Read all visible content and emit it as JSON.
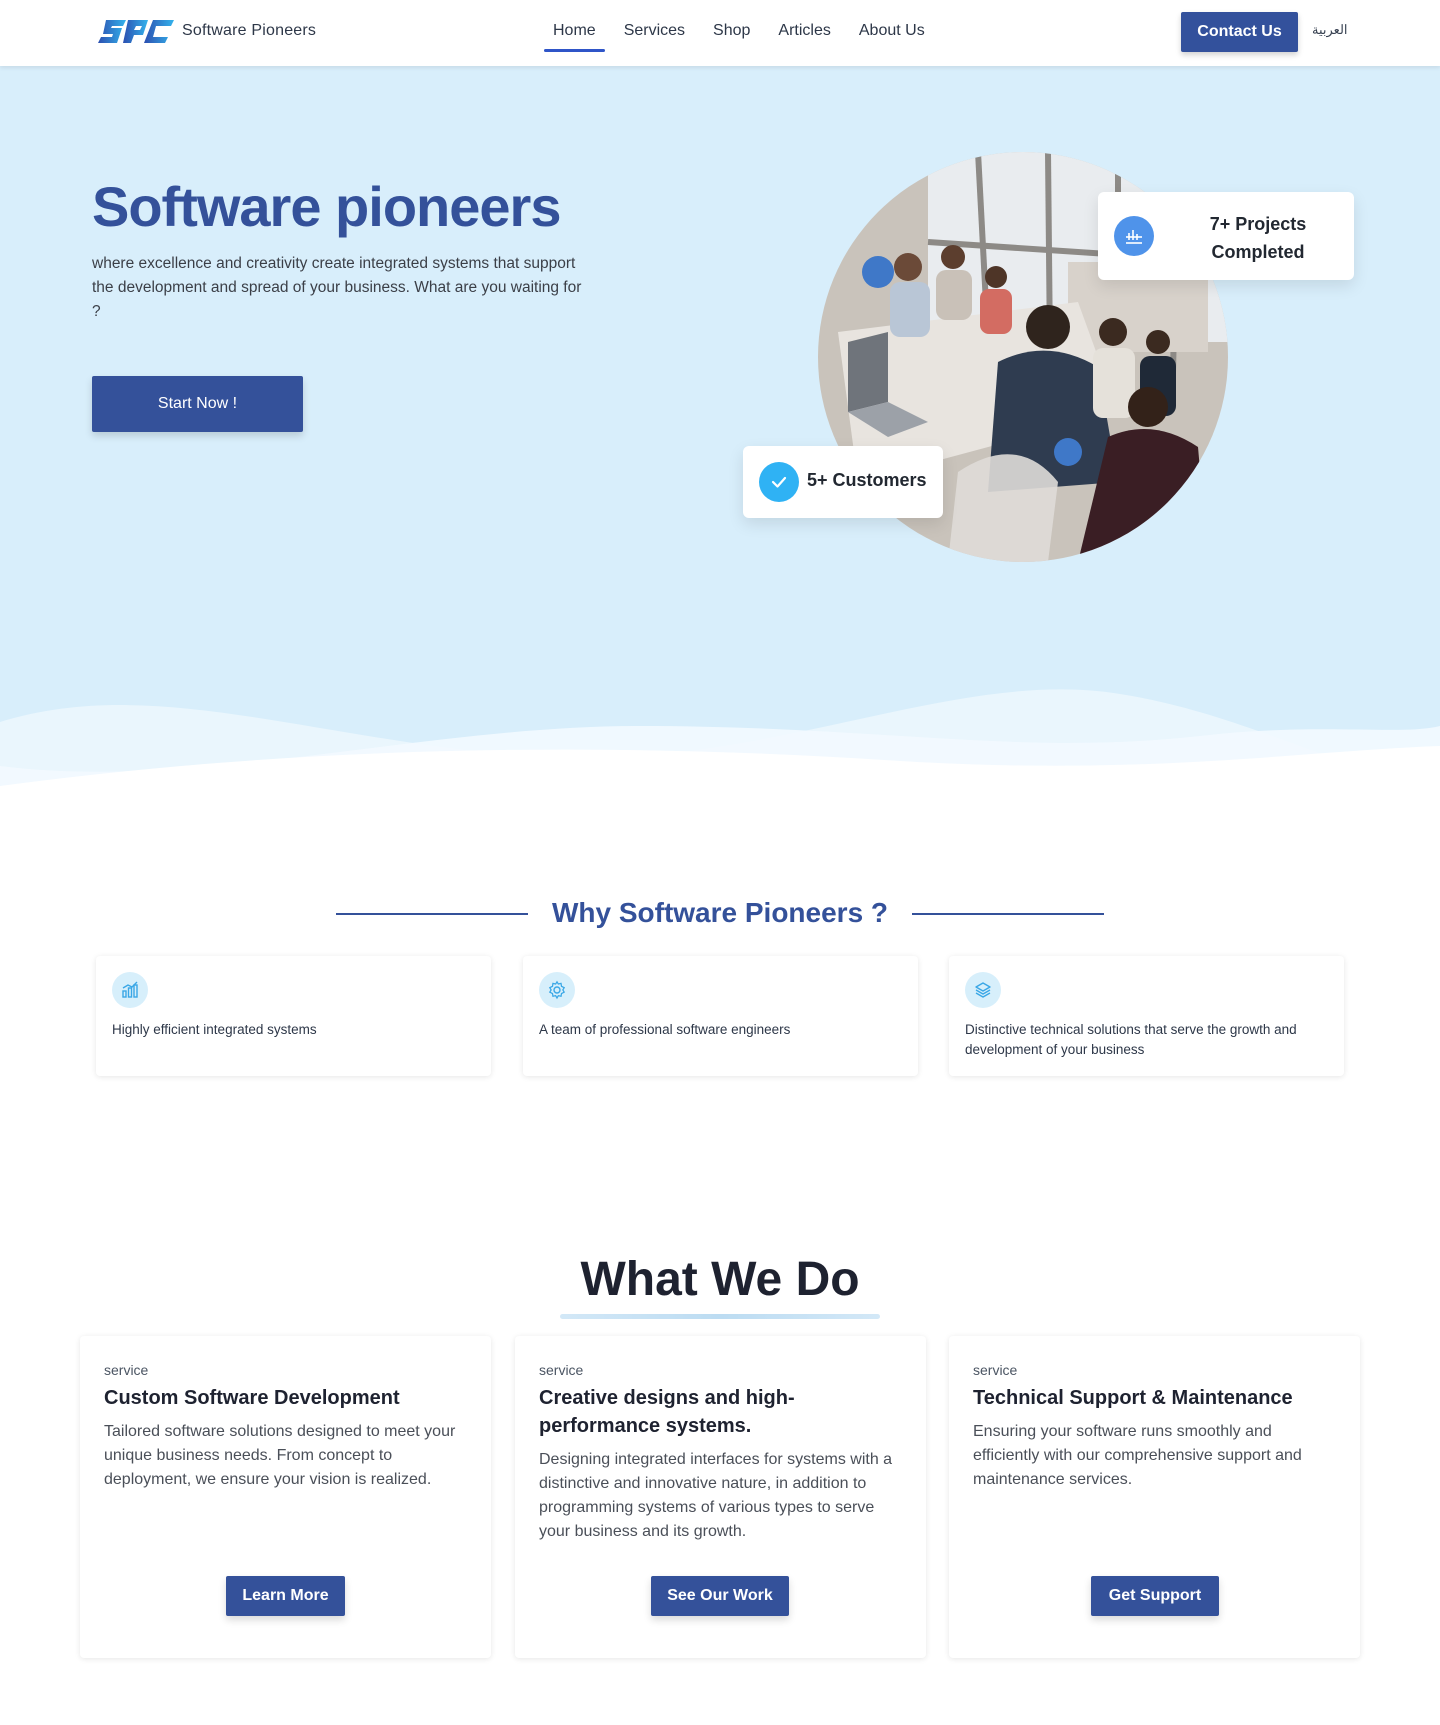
{
  "nav": {
    "brand": "Software Pioneers",
    "links": [
      "Home",
      "Services",
      "Shop",
      "Articles",
      "About Us"
    ],
    "active": "Home",
    "contact_label": "Contact Us",
    "language_label": "العربية"
  },
  "hero": {
    "title": "Software pioneers",
    "description": "where excellence and creativity create integrated systems that support the development and spread of your business. What are you waiting for ?",
    "cta_label": "Start Now !",
    "stats": {
      "projects": "7+ Projects Completed",
      "customers": "5+ Customers"
    },
    "colors": {
      "background": "#d8eefb",
      "accent": "#34519a"
    }
  },
  "why": {
    "title": "Why Software Pioneers ?",
    "features": [
      {
        "icon": "chart-icon",
        "text": "Highly efficient integrated systems"
      },
      {
        "icon": "gear-icon",
        "text": "A team of professional software engineers"
      },
      {
        "icon": "layers-icon",
        "text": "Distinctive technical solutions that serve the growth and development of your business"
      }
    ]
  },
  "what_we_do": {
    "title": "What We Do",
    "services": [
      {
        "kicker": "service",
        "title": "Custom Software Development",
        "description": "Tailored software solutions designed to meet your unique business needs. From concept to deployment, we ensure your vision is realized.",
        "button": "Learn More"
      },
      {
        "kicker": "service",
        "title": "Creative designs and high-performance systems.",
        "description": "Designing integrated interfaces for systems with a distinctive and innovative nature, in addition to programming systems of various types to serve your business and its growth.",
        "button": "See Our Work"
      },
      {
        "kicker": "service",
        "title": "Technical Support & Maintenance",
        "description": "Ensuring your software runs smoothly and efficiently with our comprehensive support and maintenance services.",
        "button": "Get Support"
      }
    ]
  }
}
